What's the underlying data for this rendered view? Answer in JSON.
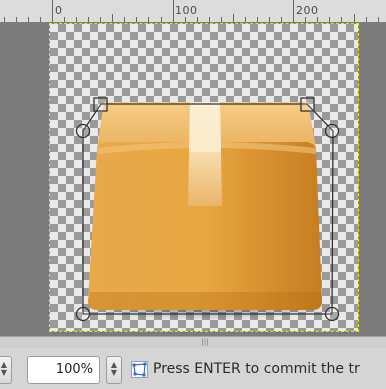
{
  "ruler": {
    "labels": [
      "0",
      "100",
      "200"
    ]
  },
  "canvas": {
    "object_icon": "cardboard-box-icon",
    "colors": {
      "box_main": "#e2a040",
      "box_light": "#f2c67a",
      "box_dark": "#c07a1e",
      "tape": "#f6dfb8",
      "transform_frame": "#3a3a3a",
      "selection_outline": "#e8e800"
    }
  },
  "statusbar": {
    "zoom_value": "100%",
    "status_icon": "transform-cage-icon",
    "message": "Press ENTER to commit the tr"
  }
}
